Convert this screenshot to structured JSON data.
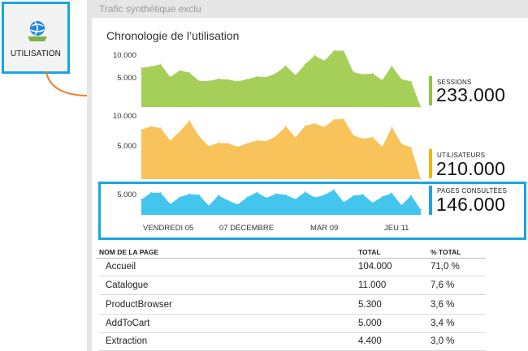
{
  "tile": {
    "label": "UTILISATION",
    "icon": "globe-app-icon"
  },
  "blade": {
    "title": "Trafic synthétique exclu"
  },
  "chart": {
    "title": "Chronologie de l’utilisation",
    "x_ticks": [
      "VENDREDI 05",
      "07 DÉCEMBRE",
      "MAR 09",
      "JEU 11"
    ]
  },
  "metrics": [
    {
      "label": "SESSIONS",
      "value": "233.000",
      "color": "#8cc63f"
    },
    {
      "label": "UTILISATEURS",
      "value": "210.000",
      "color": "#f2b705"
    },
    {
      "label": "PAGES CONSULTÉES",
      "value": "146.000",
      "color": "#1aa5e0"
    }
  ],
  "chart_data": [
    {
      "type": "area",
      "series": [
        {
          "name": "SESSIONS",
          "color": "#a6cf5a",
          "values": [
            8900,
            9200,
            9700,
            6800,
            8300,
            7800,
            5900,
            5900,
            6400,
            6200,
            5800,
            6300,
            6900,
            6800,
            7700,
            9400,
            7200,
            9700,
            11700,
            10500,
            12800,
            12800,
            7900,
            7400,
            7600,
            6100,
            9300,
            6300,
            5800,
            0
          ]
        }
      ],
      "y_ticks": [
        "10.000",
        "5.000"
      ],
      "ylim": [
        0,
        14000
      ]
    },
    {
      "type": "area",
      "series": [
        {
          "name": "UTILISATEURS",
          "color": "#f7c35a",
          "values": [
            8700,
            9300,
            9000,
            6800,
            8400,
            10300,
            7500,
            5800,
            6400,
            6300,
            5700,
            6300,
            6800,
            6700,
            7600,
            9300,
            7300,
            9400,
            9800,
            9200,
            10500,
            10600,
            7700,
            7100,
            7400,
            5700,
            9200,
            6200,
            5600,
            0
          ]
        }
      ],
      "y_ticks": [
        "10.000",
        "5.000"
      ],
      "ylim": [
        0,
        14000
      ]
    },
    {
      "type": "area",
      "series": [
        {
          "name": "PAGES CONSULTÉES",
          "color": "#44c5ee",
          "values": [
            3500,
            5100,
            5100,
            2500,
            4100,
            4800,
            4600,
            2100,
            4500,
            3300,
            2400,
            4100,
            5200,
            3900,
            4900,
            4600,
            3600,
            5300,
            4000,
            4600,
            5800,
            2900,
            4400,
            4700,
            2800,
            4200,
            5000,
            2200,
            4500,
            1200
          ]
        }
      ],
      "y_ticks": [
        "5.000"
      ],
      "ylim": [
        0,
        7500
      ]
    }
  ],
  "table": {
    "columns": [
      "NOM DE LA PAGE",
      "TOTAL",
      "% TOTAL"
    ],
    "rows": [
      [
        "Accueil",
        "104.000",
        "71,0 %"
      ],
      [
        "Catalogue",
        "11.000",
        "7,6 %"
      ],
      [
        "ProductBrowser",
        "5.300",
        "3,6 %"
      ],
      [
        "AddToCart",
        "5.000",
        "3,4 %"
      ],
      [
        "Extraction",
        "4.400",
        "3,0 %"
      ]
    ]
  }
}
